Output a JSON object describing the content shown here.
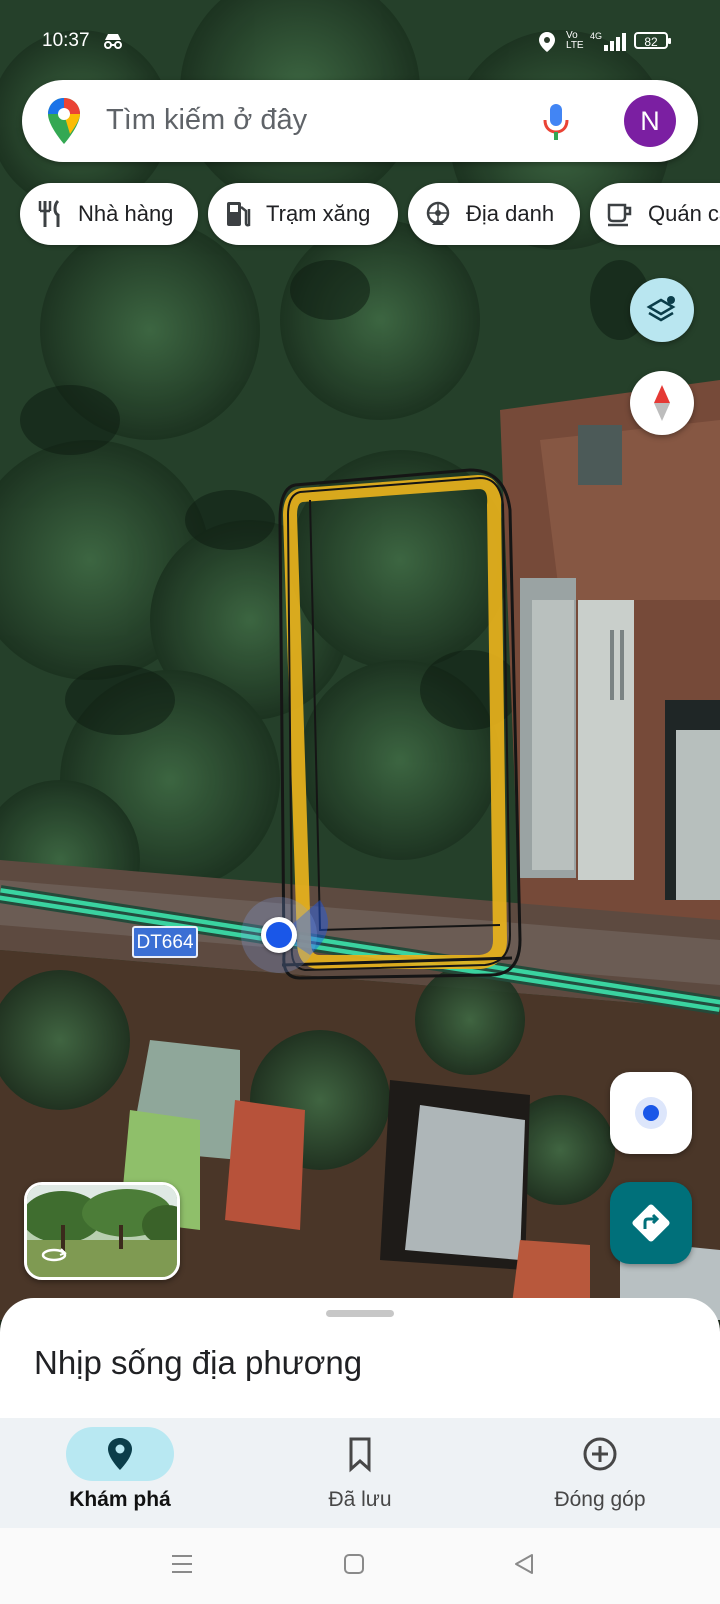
{
  "status_bar": {
    "time": "10:37",
    "incognito_glyph": "ꝏ",
    "location_glyph": "⬤",
    "network_glyph": "Vo LTE 4G",
    "signal_glyph": "▂▄▆█",
    "battery_level": "82"
  },
  "search": {
    "placeholder": "Tìm kiếm ở đây",
    "avatar_initial": "N",
    "logo_icon": "maps-pin-logo-icon",
    "mic_icon": "microphone-icon"
  },
  "chips": [
    {
      "label": "Nhà hàng",
      "icon": "fork-knife-icon"
    },
    {
      "label": "Trạm xăng",
      "icon": "gas-pump-icon"
    },
    {
      "label": "Địa danh",
      "icon": "landmark-icon"
    },
    {
      "label": "Quán cà phê",
      "icon": "coffee-cup-icon"
    }
  ],
  "map": {
    "road_label": "DT664",
    "layers_icon": "layers-icon",
    "compass_icon": "compass-icon",
    "my_location_icon": "my-location-icon",
    "directions_icon": "directions-icon"
  },
  "sheet": {
    "title": "Nhịp sống địa phương"
  },
  "bottom_nav": [
    {
      "label": "Khám phá",
      "icon": "explore-pin-icon",
      "active": true
    },
    {
      "label": "Đã lưu",
      "icon": "bookmark-icon",
      "active": false
    },
    {
      "label": "Đóng góp",
      "icon": "add-circle-icon",
      "active": false
    }
  ],
  "colors": {
    "accent_teal": "#00707a",
    "active_pill": "#b8e8f2",
    "location_blue": "#1a57e8",
    "road_line": "#3ad3a0",
    "drawn_outline_yellow": "#e8b21c",
    "avatar_purple": "#7b1fa2"
  }
}
